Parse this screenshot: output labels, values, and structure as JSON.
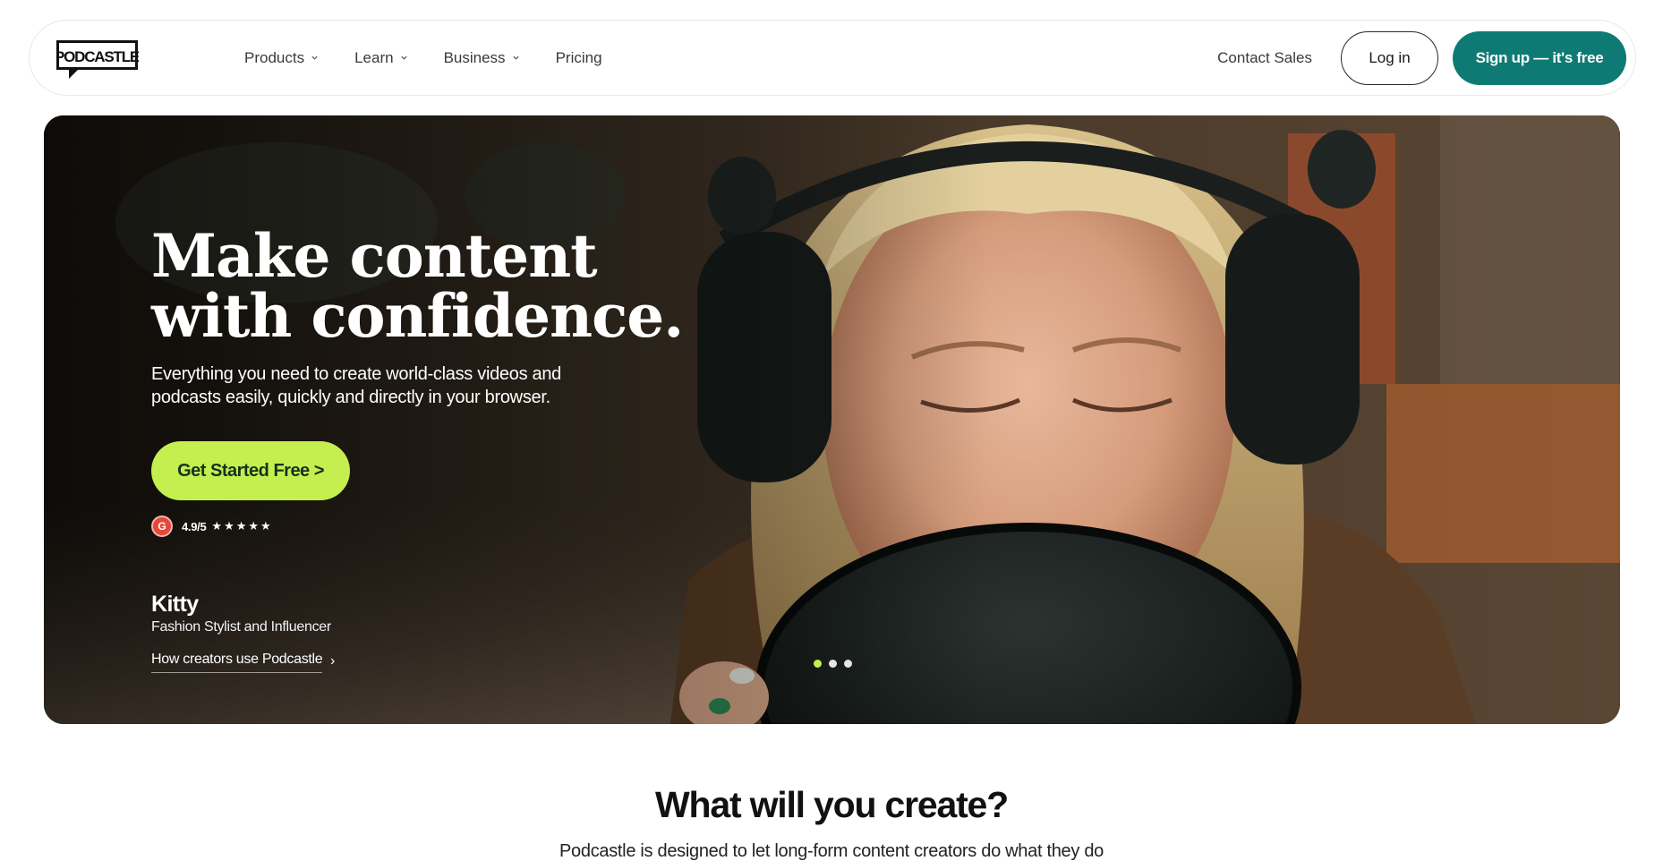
{
  "nav": {
    "logo_text": "PODCASTLE",
    "menu": [
      {
        "label": "Products",
        "has_dropdown": true
      },
      {
        "label": "Learn",
        "has_dropdown": true
      },
      {
        "label": "Business",
        "has_dropdown": true
      },
      {
        "label": "Pricing",
        "has_dropdown": false
      }
    ],
    "contact_label": "Contact Sales",
    "login_label": "Log in",
    "signup_label": "Sign up — it's free"
  },
  "hero": {
    "headline_line1": "Make content",
    "headline_line2": "with confidence.",
    "subhead": "Everything you need to create world-class videos and podcasts easily, quickly and directly in your browser.",
    "cta_label": "Get Started Free >",
    "rating_badge": "G",
    "rating_value": "4.9/5",
    "rating_stars": "★★★★★",
    "person_name": "Kitty",
    "person_role": "Fashion Stylist and Influencer",
    "story_link": "How creators use Podcastle",
    "story_arrow": "›",
    "carousel": {
      "total": 3,
      "active": 1
    }
  },
  "section": {
    "title": "What will you create?",
    "subtitle": "Podcastle is designed to let long-form content creators do what they do"
  },
  "colors": {
    "brand_teal": "#0f7a74",
    "accent_lime": "#c4ef4f",
    "g2_red": "#e5483a"
  }
}
